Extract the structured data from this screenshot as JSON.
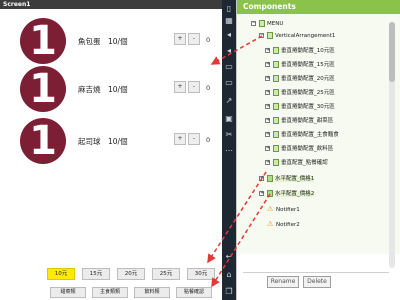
{
  "screen": {
    "title": "Screen1",
    "items": [
      {
        "number": "1",
        "name": "魚包蛋",
        "price": "10/個",
        "minus": "-",
        "plus": "+",
        "qty": "0"
      },
      {
        "number": "1",
        "name": "麻吉燒",
        "price": "10/個",
        "minus": "-",
        "plus": "+",
        "qty": "0"
      },
      {
        "number": "1",
        "name": "起司球",
        "price": "10/個",
        "minus": "-",
        "plus": "+",
        "qty": "0"
      }
    ],
    "price_buttons": [
      "10元",
      "15元",
      "20元",
      "25元",
      "30元"
    ],
    "active_price_index": 0,
    "category_buttons": [
      "甜菜類",
      "主食類類",
      "飲料類",
      "點餐確認"
    ]
  },
  "palette": {
    "icons": [
      "phone-icon",
      "layout-icon",
      "speaker-icon",
      "speaker-icon",
      "tablet-icon",
      "monitor-icon",
      "arrow-icon",
      "toolbox-icon",
      "scissors-icon",
      "more-icon",
      "back-icon",
      "home-icon",
      "recent-icon"
    ]
  },
  "components": {
    "title": "Components",
    "tree": [
      {
        "label": "MENU",
        "level": 0,
        "expander": "−",
        "icon": "screen"
      },
      {
        "label": "VerticalArrangement1",
        "level": 1,
        "expander": "−",
        "icon": "box"
      },
      {
        "label": "垂直捲動配置_10元區",
        "level": 2,
        "expander": "+",
        "icon": "box"
      },
      {
        "label": "垂直捲動配置_15元區",
        "level": 2,
        "expander": "+",
        "icon": "box"
      },
      {
        "label": "垂直捲動配置_20元區",
        "level": 2,
        "expander": "+",
        "icon": "box"
      },
      {
        "label": "垂直捲動配置_25元區",
        "level": 2,
        "expander": "+",
        "icon": "box"
      },
      {
        "label": "垂直捲動配置_30元區",
        "level": 2,
        "expander": "+",
        "icon": "box"
      },
      {
        "label": "垂直捲動配置_甜菜區",
        "level": 2,
        "expander": "+",
        "icon": "box"
      },
      {
        "label": "垂直捲動配置_主食麵食",
        "level": 2,
        "expander": "+",
        "icon": "box"
      },
      {
        "label": "垂直捲動配置_飲料區",
        "level": 2,
        "expander": "+",
        "icon": "box"
      },
      {
        "label": "垂直配置_點餐確認",
        "level": 2,
        "expander": "+",
        "icon": "box"
      },
      {
        "label": "水平配置_價格1",
        "level": 1,
        "expander": "+",
        "icon": "img"
      },
      {
        "label": "水平配置_價格2",
        "level": 1,
        "expander": "+",
        "icon": "img"
      },
      {
        "label": "Notifier1",
        "level": 1,
        "expander": "",
        "icon": "warn"
      },
      {
        "label": "Notifier2",
        "level": 1,
        "expander": "",
        "icon": "warn"
      }
    ],
    "rename_label": "Rename",
    "delete_label": "Delete"
  },
  "colors": {
    "circle": "#7d1f34",
    "header_green": "#8bc34a",
    "active_yellow": "#ffea00",
    "arrow_red": "#e53935"
  }
}
